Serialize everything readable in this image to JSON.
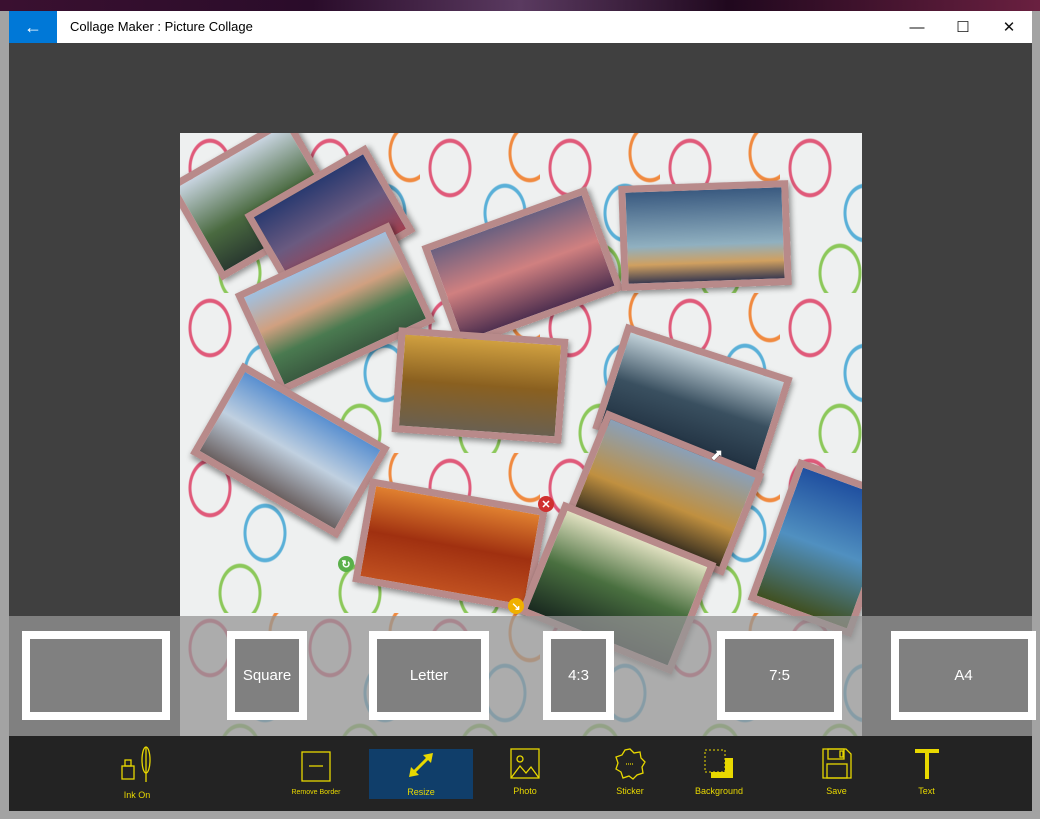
{
  "window": {
    "title": "Collage Maker : Picture Collage",
    "back_icon": "arrow-left-icon",
    "minimize": "minimize-icon",
    "maximize": "maximize-icon",
    "close": "close-icon"
  },
  "aspect_options": [
    {
      "label": ""
    },
    {
      "label": "Square"
    },
    {
      "label": "Letter"
    },
    {
      "label": "4:3"
    },
    {
      "label": "7:5"
    },
    {
      "label": "A4"
    }
  ],
  "toolbar": {
    "items": [
      {
        "label": "Ink On"
      },
      {
        "label": "Remove Border"
      },
      {
        "label": "Resize"
      },
      {
        "label": "Photo"
      },
      {
        "label": "Sticker"
      },
      {
        "label": "Background"
      },
      {
        "label": "Save"
      },
      {
        "label": "Text"
      }
    ],
    "accent": "#e8d800",
    "active_bg": "#103e6a"
  },
  "colors": {
    "titlebar_accent": "#0078d7",
    "photo_border": "#b88a8a"
  }
}
